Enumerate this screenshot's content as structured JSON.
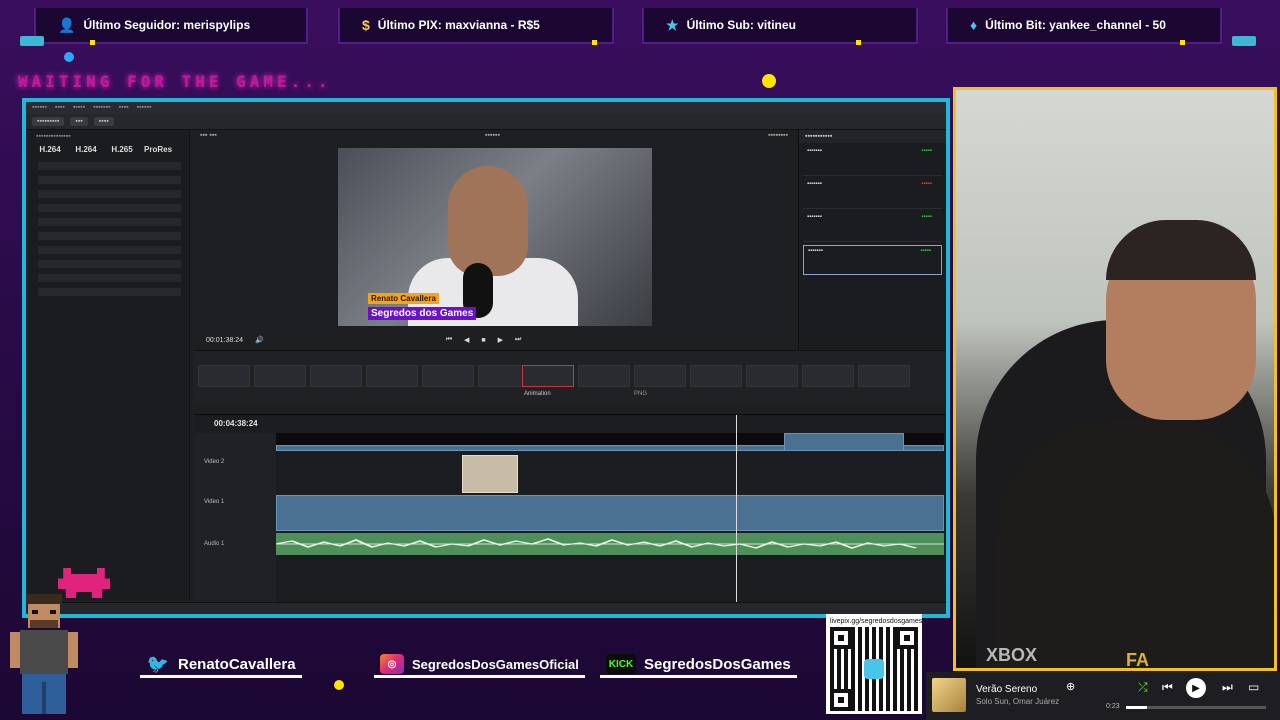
{
  "alerts": {
    "follower": {
      "icon": "person-icon",
      "text": "Último Seguidor: merispylips"
    },
    "pix": {
      "icon": "dollar-icon",
      "text": "Último PIX: maxvianna - R$5"
    },
    "sub": {
      "icon": "star-icon",
      "text": "Último Sub: vitineu"
    },
    "bit": {
      "icon": "diamond-icon",
      "text": "Último Bit: yankee_channel - 50"
    }
  },
  "status_text": "WAITING FOR THE GAME...",
  "editor": {
    "codecs": [
      {
        "label": "H.264"
      },
      {
        "label": "H.264"
      },
      {
        "label": "H.265"
      },
      {
        "label": "ProRes"
      }
    ],
    "timecode_transport": "00:01:38:24",
    "timecode_timeline": "00:04:38:24",
    "track_labels": [
      "Video 2",
      "Video 1",
      "Audio 1"
    ],
    "video_overlay": {
      "name": "Renato Cavallera",
      "title": "Segredos dos Games"
    },
    "clip_labels": [
      "Animation",
      "PNG"
    ]
  },
  "socials": [
    {
      "platform": "twitter",
      "handle": "RenatoCavallera",
      "icon": "twitter-icon"
    },
    {
      "platform": "instagram",
      "handle": "SegredosDosGamesOficial",
      "icon": "instagram-icon"
    },
    {
      "platform": "kick",
      "badge": "KICK",
      "handle": "SegredosDosGames",
      "icon": "kick-icon"
    }
  ],
  "qr": {
    "url": "livepix.gg/segredosdosgames"
  },
  "webcam": {
    "shirt_text_1": "XBOX",
    "shirt_text_2": "FA"
  },
  "music_player": {
    "song": "Verão Sereno",
    "artist": "Solo Sun, Omar Juárez",
    "time": "0:23",
    "progress": 0.15
  },
  "colors": {
    "accent_cyan": "#20b8d8",
    "accent_yellow": "#f4c21a",
    "accent_magenta": "#c2189a",
    "background": "#2b0b4a"
  }
}
